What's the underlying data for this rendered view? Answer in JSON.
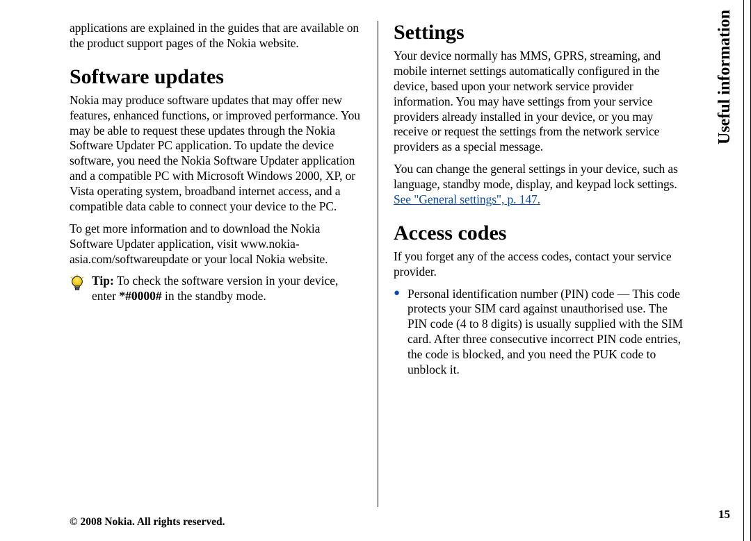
{
  "sideTab": "Useful information",
  "pageNumber": "15",
  "copyright": "© 2008 Nokia. All rights reserved.",
  "left": {
    "introPara": "applications are explained in the guides that are available on the product support pages of the Nokia website.",
    "h_software": "Software updates",
    "sw_p1": "Nokia may produce software updates that may offer new features, enhanced functions, or improved performance. You may be able to request these updates through the Nokia Software Updater PC application. To update the device software, you need the Nokia Software Updater application and a compatible PC with Microsoft Windows 2000, XP, or Vista operating system, broadband internet access, and a compatible data cable to connect your device to the PC.",
    "sw_p2": "To get more information and to download the Nokia Software Updater application, visit www.nokia-asia.com/softwareupdate or your local Nokia website.",
    "tip_label": "Tip:",
    "tip_body_a": " To check the software version in your device, enter ",
    "tip_code": "*#0000#",
    "tip_body_b": " in the standby mode."
  },
  "right": {
    "h_settings": "Settings",
    "set_p1": "Your device normally has MMS, GPRS, streaming, and mobile internet settings automatically configured in the device, based upon your network service provider information. You may have settings from your service providers already installed in your device, or you may receive or request the settings from the network service providers as a special message.",
    "set_p2a": "You can change the general settings in your device, such as language, standby mode, display, and keypad lock settings. ",
    "set_link": "See \"General settings\", p. 147.",
    "h_access": "Access codes",
    "acc_p1": "If you forget any of the access codes, contact your service provider.",
    "acc_bullet1": "Personal identification number (PIN) code — This code protects your SIM card against unauthorised use. The PIN code (4 to 8 digits) is usually supplied with the SIM card. After three consecutive incorrect PIN code entries, the code is blocked, and you need the PUK code to unblock it."
  }
}
